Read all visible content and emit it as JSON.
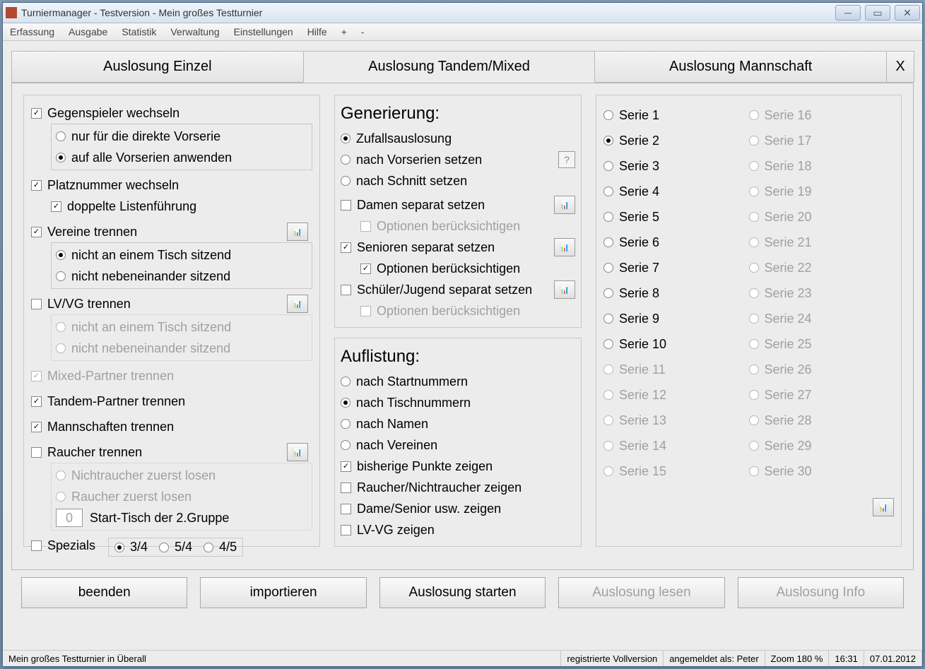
{
  "title": "Turniermanager - Testversion - Mein großes Testturnier",
  "menu": [
    "Erfassung",
    "Ausgabe",
    "Statistik",
    "Verwaltung",
    "Einstellungen",
    "Hilfe",
    "+",
    "-"
  ],
  "tabs": {
    "t1": "Auslosung Einzel",
    "t2": "Auslosung Tandem/Mixed",
    "t3": "Auslosung Mannschaft",
    "x": "X"
  },
  "c1": {
    "gegen": "Gegenspieler wechseln",
    "gegen_r1": "nur für die direkte Vorserie",
    "gegen_r2": "auf alle Vorserien anwenden",
    "platz": "Platznummer wechseln",
    "platz_c1": "doppelte Listenführung",
    "verein": "Vereine trennen",
    "verein_r1": "nicht an einem Tisch sitzend",
    "verein_r2": "nicht nebeneinander sitzend",
    "lvvg": "LV/VG trennen",
    "lvvg_r1": "nicht an einem Tisch sitzend",
    "lvvg_r2": "nicht nebeneinander sitzend",
    "mixed": "Mixed-Partner trennen",
    "tandem": "Tandem-Partner trennen",
    "mann": "Mannschaften trennen",
    "rauch": "Raucher trennen",
    "rauch_r1": "Nichtraucher zuerst losen",
    "rauch_r2": "Raucher zuerst losen",
    "start_n": "0",
    "start_l": "Start-Tisch der 2.Gruppe",
    "spez": "Spezials",
    "s34": "3/4",
    "s54": "5/4",
    "s45": "4/5"
  },
  "c2": {
    "gen_h": "Generierung:",
    "gen_r1": "Zufallsauslosung",
    "gen_r2": "nach Vorserien setzen",
    "gen_r3": "nach Schnitt setzen",
    "damen": "Damen separat setzen",
    "damen_o": "Optionen berücksichtigen",
    "senior": "Senioren separat setzen",
    "senior_o": "Optionen berücksichtigen",
    "schul": "Schüler/Jugend separat setzen",
    "schul_o": "Optionen berücksichtigen",
    "auf_h": "Auflistung:",
    "auf_r1": "nach Startnummern",
    "auf_r2": "nach Tischnummern",
    "auf_r3": "nach Namen",
    "auf_r4": "nach Vereinen",
    "auf_c1": "bisherige Punkte zeigen",
    "auf_c2": "Raucher/Nichtraucher zeigen",
    "auf_c3": "Dame/Senior usw. zeigen",
    "auf_c4": "LV-VG zeigen"
  },
  "series": [
    "Serie 1",
    "Serie 2",
    "Serie 3",
    "Serie 4",
    "Serie 5",
    "Serie 6",
    "Serie 7",
    "Serie 8",
    "Serie 9",
    "Serie 10",
    "Serie 11",
    "Serie 12",
    "Serie 13",
    "Serie 14",
    "Serie 15",
    "Serie 16",
    "Serie 17",
    "Serie 18",
    "Serie 19",
    "Serie 20",
    "Serie 21",
    "Serie 22",
    "Serie 23",
    "Serie 24",
    "Serie 25",
    "Serie 26",
    "Serie 27",
    "Serie 28",
    "Serie 29",
    "Serie 30"
  ],
  "btn": {
    "beenden": "beenden",
    "import": "importieren",
    "start": "Auslosung starten",
    "lesen": "Auslosung lesen",
    "info": "Auslosung Info"
  },
  "status": {
    "left": "Mein großes Testturnier in Überall",
    "version": "registrierte Vollversion",
    "user": "angemeldet als: Peter",
    "zoom": "Zoom 180 %",
    "time": "16:31",
    "date": "07.01.2012"
  }
}
